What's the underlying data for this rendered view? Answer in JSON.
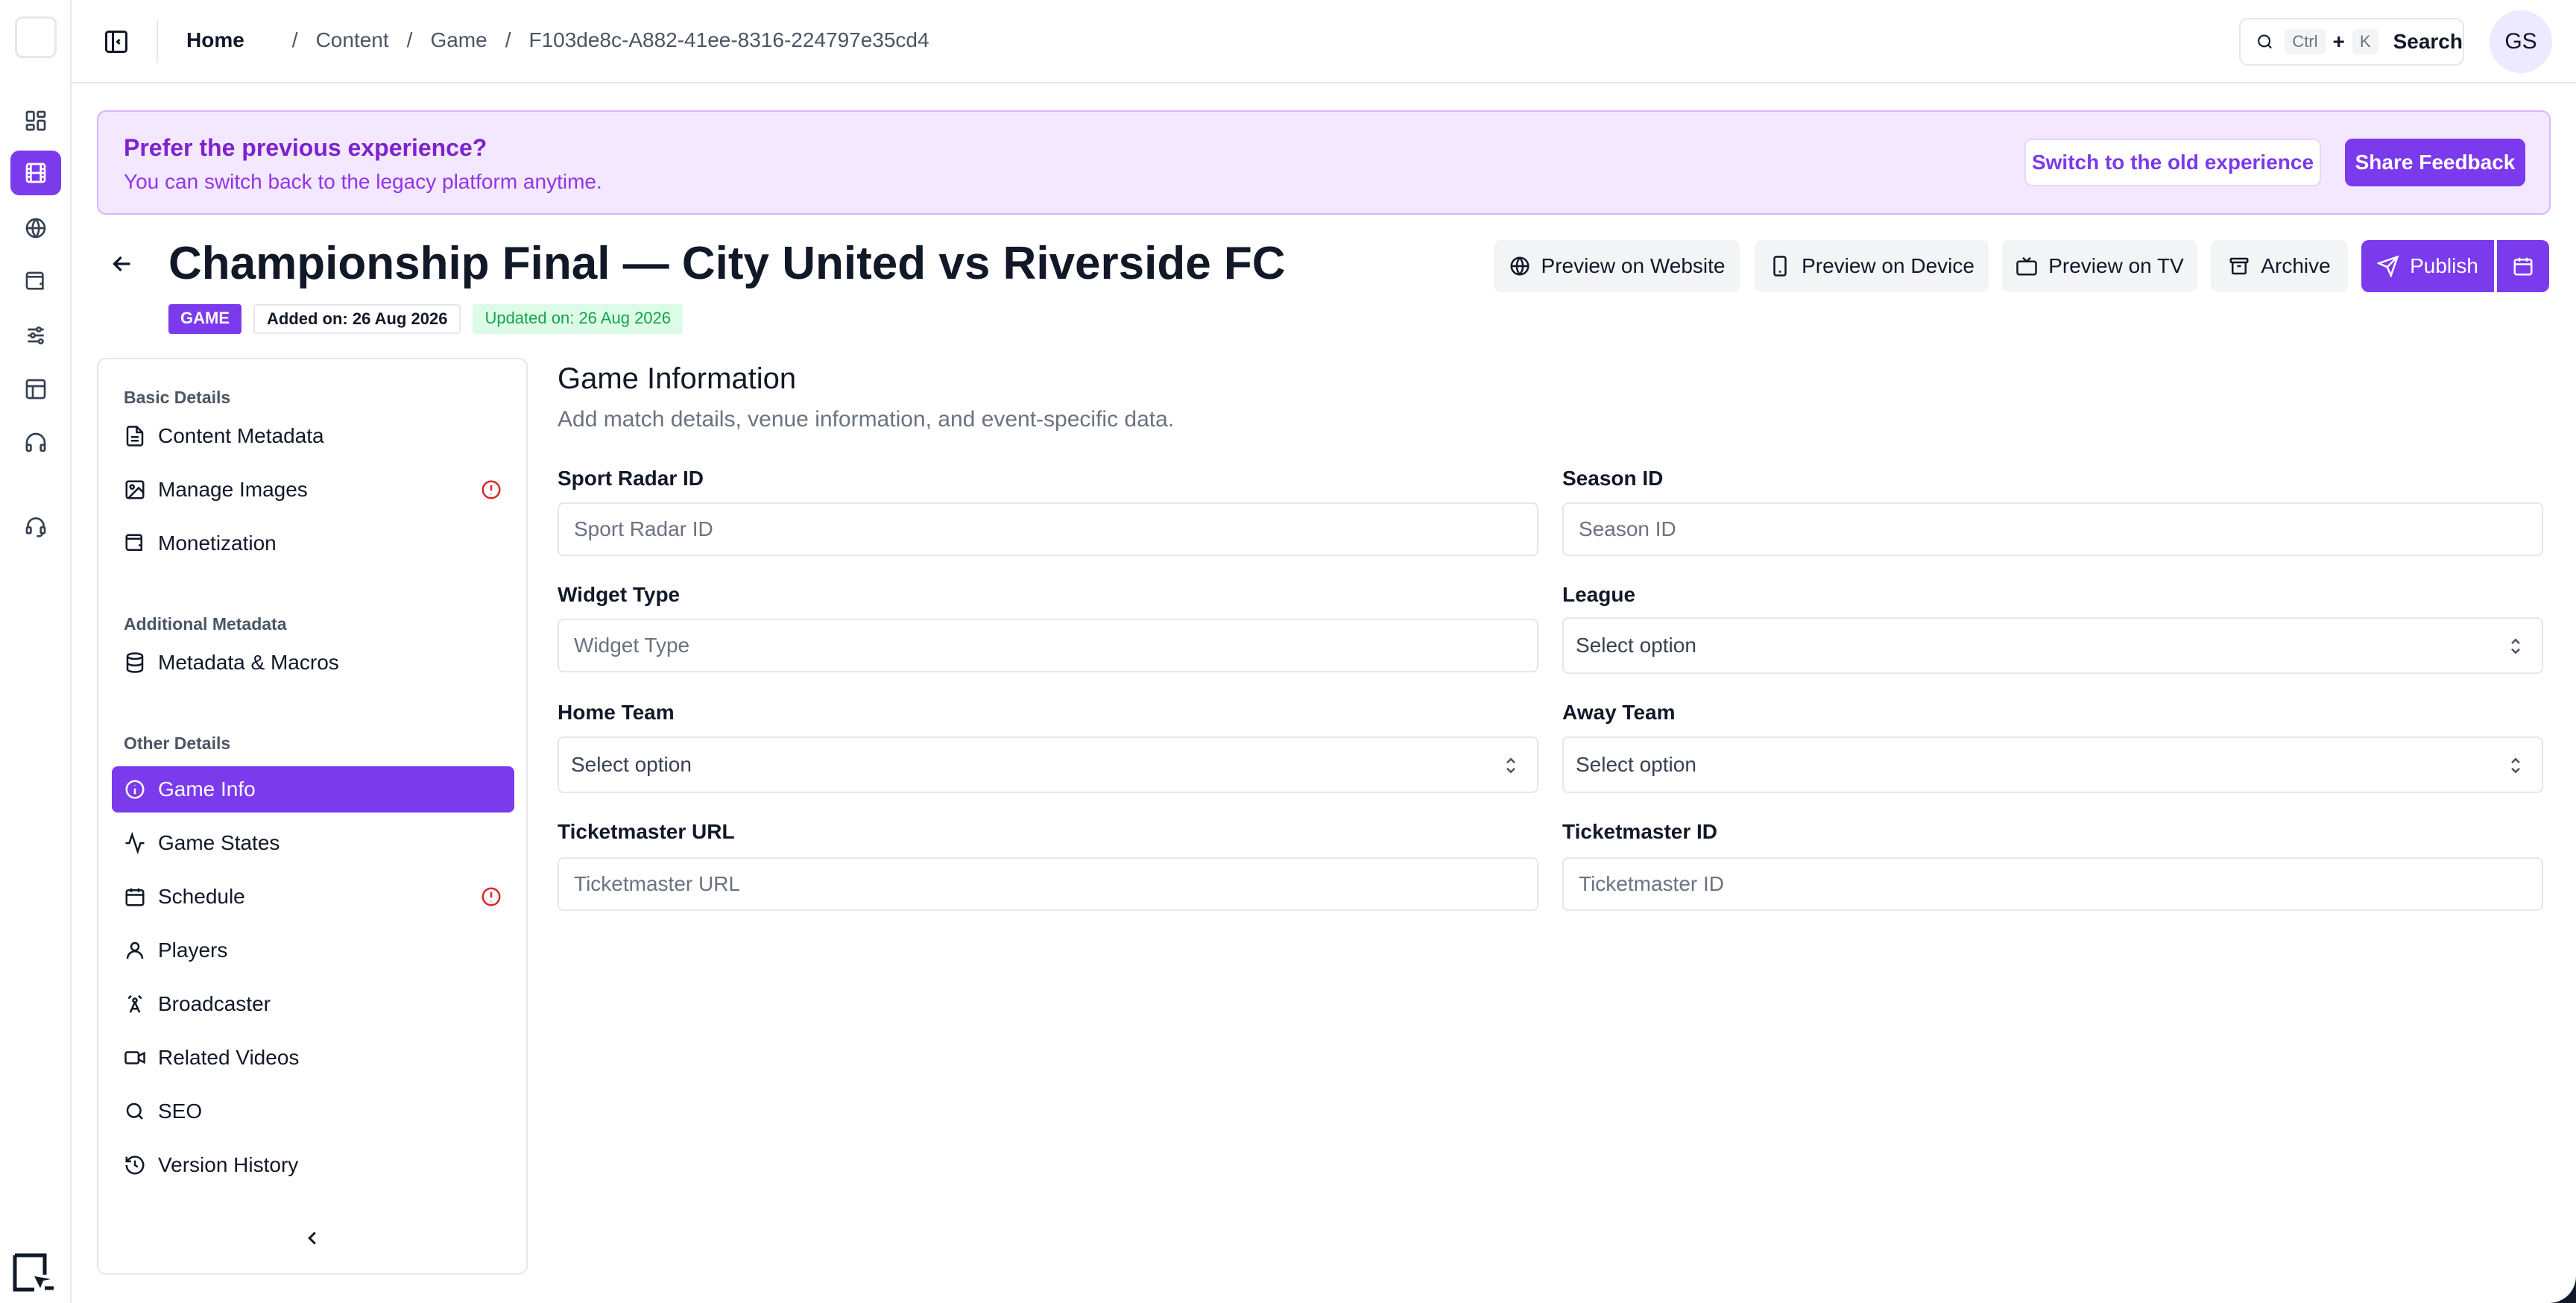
{
  "topbar": {
    "breadcrumb": [
      "Home",
      "Content",
      "Game",
      "F103de8c-A882-41ee-8316-224797e35cd4"
    ],
    "search": {
      "kbd1": "Ctrl",
      "plus": "+",
      "kbd2": "K",
      "label": "Search"
    },
    "avatar_initials": "GS"
  },
  "banner": {
    "title": "Prefer the previous experience?",
    "subtitle": "You can switch back to the legacy platform anytime.",
    "switch_label": "Switch to the old experience",
    "feedback_label": "Share Feedback"
  },
  "page": {
    "title": "Championship Final — City United vs Riverside FC",
    "badge_type": "GAME",
    "added": "Added on: 26 Aug 2026",
    "updated": "Updated on: 26 Aug 2026"
  },
  "actions": {
    "preview_website": "Preview on Website",
    "preview_device": "Preview on Device",
    "preview_tv": "Preview on TV",
    "archive": "Archive",
    "publish": "Publish"
  },
  "sidenav": {
    "sections": [
      "Basic Details",
      "Additional Metadata",
      "Other Details"
    ],
    "items": [
      {
        "label": "Content Metadata",
        "icon": "document-icon"
      },
      {
        "label": "Manage Images",
        "icon": "image-icon",
        "alert": true
      },
      {
        "label": "Monetization",
        "icon": "wallet-icon"
      },
      {
        "label": "Metadata & Macros",
        "icon": "database-icon"
      },
      {
        "label": "Game Info",
        "icon": "info-icon",
        "active": true
      },
      {
        "label": "Game States",
        "icon": "activity-icon"
      },
      {
        "label": "Schedule",
        "icon": "calendar-icon",
        "alert": true
      },
      {
        "label": "Players",
        "icon": "user-icon"
      },
      {
        "label": "Broadcaster",
        "icon": "tower-icon"
      },
      {
        "label": "Related Videos",
        "icon": "video-icon"
      },
      {
        "label": "SEO",
        "icon": "search-icon"
      },
      {
        "label": "Version History",
        "icon": "history-icon"
      }
    ]
  },
  "form": {
    "title": "Game Information",
    "subtitle": "Add match details, venue information, and event-specific data.",
    "sport_radar_id": {
      "label": "Sport Radar ID",
      "placeholder": "Sport Radar ID",
      "value": ""
    },
    "season_id": {
      "label": "Season ID",
      "placeholder": "Season ID",
      "value": ""
    },
    "widget_type": {
      "label": "Widget Type",
      "placeholder": "Widget Type",
      "value": ""
    },
    "league": {
      "label": "League",
      "selected": "Select option"
    },
    "home_team": {
      "label": "Home Team",
      "selected": "Select option"
    },
    "away_team": {
      "label": "Away Team",
      "selected": "Select option"
    },
    "ticketmaster_url": {
      "label": "Ticketmaster URL",
      "placeholder": "Ticketmaster URL",
      "value": ""
    },
    "ticketmaster_id": {
      "label": "Ticketmaster ID",
      "placeholder": "Ticketmaster ID",
      "value": ""
    }
  },
  "colors": {
    "accent": "#7c3aed",
    "banner_bg": "#f3e8ff",
    "alert": "#dc2626",
    "updated_green": "#16a34a"
  }
}
